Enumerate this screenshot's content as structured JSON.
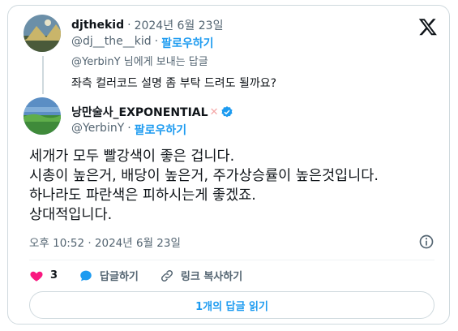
{
  "reply_tweet": {
    "display_name": "djthekid",
    "date": "2024년 6월 23일",
    "handle": "@dj__the__kid",
    "follow_label": "팔로우하기",
    "replying_to": "@YerbinY 님에게 보내는 답글",
    "text": "좌측 컬러코드 설명 좀 부탁 드려도 될까요?"
  },
  "main_tweet": {
    "display_name": "낭만술사_EXPONENTIAL",
    "handle": "@YerbinY",
    "follow_label": "팔로우하기",
    "text_lines": [
      "세개가 모두 빨강색이 좋은 겁니다.",
      "시총이 높은거, 배당이 높은거, 주가상승률이 높은것입니다.",
      "하나라도 파란색은 피하시는게 좋겠죠.",
      "상대적입니다."
    ],
    "timestamp": "오후 10:52 · 2024년 6월 23일"
  },
  "actions": {
    "like_count": "3",
    "reply_label": "답글하기",
    "copy_link_label": "링크 복사하기"
  },
  "read_replies_label": "1개의 답글 읽기",
  "colors": {
    "accent": "#1d9bf0",
    "like": "#f91880",
    "muted": "#536471",
    "border": "#cfd9de"
  },
  "icons": [
    "x-logo-icon",
    "verified-icon",
    "syringe-emoji-icon",
    "info-icon",
    "heart-icon",
    "reply-icon",
    "link-icon"
  ]
}
